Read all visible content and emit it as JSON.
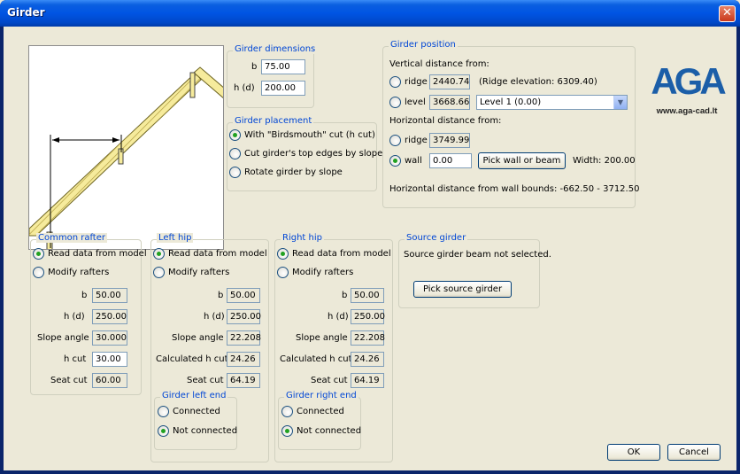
{
  "window": {
    "title": "Girder",
    "close_symbol": "✕"
  },
  "logo": {
    "brand_text": "AGA",
    "url": "www.aga-cad.lt"
  },
  "dimensions": {
    "legend": "Girder dimensions",
    "b_label": "b",
    "b_value": "75.00",
    "h_label": "h (d)",
    "h_value": "200.00"
  },
  "placement": {
    "legend": "Girder placement",
    "options": [
      "With \"Birdsmouth\" cut (h cut)",
      "Cut girder's top edges by slope",
      "Rotate girder by slope"
    ],
    "selected_index": 0
  },
  "position": {
    "legend": "Girder position",
    "vertical_label": "Vertical distance from:",
    "ridge_label": "ridge",
    "ridge_value": "2440.74",
    "ridge_note": "(Ridge elevation: 6309.40)",
    "level_label": "level",
    "level_value": "3668.66",
    "level_select": "Level 1 (0.00)",
    "horizontal_label": "Horizontal distance from:",
    "h_ridge_label": "ridge",
    "h_ridge_value": "3749.99",
    "wall_label": "wall",
    "wall_value": "0.00",
    "pick_wall_button": "Pick wall or beam",
    "width_text": "Width: 200.00",
    "bounds_text": "Horizontal distance from wall bounds: -662.50 - 3712.50"
  },
  "common_rafter": {
    "legend": "Common rafter",
    "read_label": "Read data from model",
    "modify_label": "Modify rafters",
    "b_label": "b",
    "b_value": "50.00",
    "h_label": "h (d)",
    "h_value": "250.00",
    "slope_label": "Slope angle",
    "slope_value": "30.000",
    "hcut_label": "h cut",
    "hcut_value": "30.00",
    "seat_label": "Seat cut",
    "seat_value": "60.00"
  },
  "left_hip": {
    "legend": "Left hip",
    "read_label": "Read data from model",
    "modify_label": "Modify rafters",
    "b_label": "b",
    "b_value": "50.00",
    "h_label": "h (d)",
    "h_value": "250.00",
    "slope_label": "Slope angle",
    "slope_value": "22.208",
    "hcut_label": "Calculated h cut",
    "hcut_value": "24.26",
    "seat_label": "Seat cut",
    "seat_value": "64.19",
    "end_legend": "Girder left end",
    "connected_label": "Connected",
    "not_connected_label": "Not connected"
  },
  "right_hip": {
    "legend": "Right hip",
    "read_label": "Read data from model",
    "modify_label": "Modify rafters",
    "b_label": "b",
    "b_value": "50.00",
    "h_label": "h (d)",
    "h_value": "250.00",
    "slope_label": "Slope angle",
    "slope_value": "22.208",
    "hcut_label": "Calculated h cut",
    "hcut_value": "24.26",
    "seat_label": "Seat cut",
    "seat_value": "64.19",
    "end_legend": "Girder right end",
    "connected_label": "Connected",
    "not_connected_label": "Not connected"
  },
  "source": {
    "legend": "Source girder",
    "status_text": "Source girder beam not selected.",
    "pick_button": "Pick source girder"
  },
  "footer": {
    "ok_label": "OK",
    "cancel_label": "Cancel"
  },
  "colors": {
    "title_bar": "#0054e3",
    "legend_text": "#0046d5",
    "radio_dot": "#21a121",
    "dialog_bg": "#ece9d8",
    "logo_blue": "#1b5ea8"
  }
}
